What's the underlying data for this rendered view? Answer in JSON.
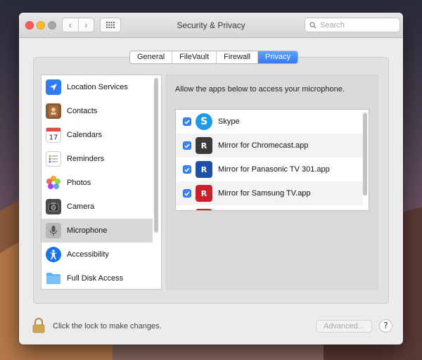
{
  "window": {
    "title": "Security & Privacy",
    "search_placeholder": "Search",
    "nav_back": "‹",
    "nav_forward": "›"
  },
  "tabs": [
    {
      "label": "General",
      "active": false
    },
    {
      "label": "FileVault",
      "active": false
    },
    {
      "label": "Firewall",
      "active": false
    },
    {
      "label": "Privacy",
      "active": true
    }
  ],
  "sidebar": {
    "selected": "Microphone",
    "items": [
      {
        "label": "Location Services",
        "icon": "location-arrow-icon"
      },
      {
        "label": "Contacts",
        "icon": "contacts-book-icon"
      },
      {
        "label": "Calendars",
        "icon": "calendar-icon",
        "calendar_day": "17"
      },
      {
        "label": "Reminders",
        "icon": "reminders-list-icon"
      },
      {
        "label": "Photos",
        "icon": "photos-flower-icon"
      },
      {
        "label": "Camera",
        "icon": "camera-icon"
      },
      {
        "label": "Microphone",
        "icon": "microphone-icon"
      },
      {
        "label": "Accessibility",
        "icon": "accessibility-person-icon"
      },
      {
        "label": "Full Disk Access",
        "icon": "folder-icon"
      }
    ]
  },
  "content": {
    "title": "Allow the apps below to access your microphone.",
    "apps": [
      {
        "label": "Skype",
        "checked": true,
        "icon": "skype-icon"
      },
      {
        "label": "Mirror for Chromecast.app",
        "checked": true,
        "icon": "mirror-chromecast-icon",
        "icon_text": "R"
      },
      {
        "label": "Mirror for Panasonic TV 301.app",
        "checked": true,
        "icon": "mirror-panasonic-icon",
        "icon_text": "R"
      },
      {
        "label": "Mirror for Samsung TV.app",
        "checked": true,
        "icon": "mirror-samsung-icon",
        "icon_text": "R"
      }
    ]
  },
  "footer": {
    "lock_text": "Click the lock to make changes.",
    "advanced_label": "Advanced...",
    "help_label": "?"
  },
  "colors": {
    "accent": "#3478f6",
    "close": "#fc5f57",
    "minimize": "#fdbb2d",
    "skype": "#1e9be8",
    "mirror_chromecast": "#3a3a3a",
    "mirror_panasonic": "#1f4fa8",
    "mirror_samsung": "#c9202a"
  }
}
